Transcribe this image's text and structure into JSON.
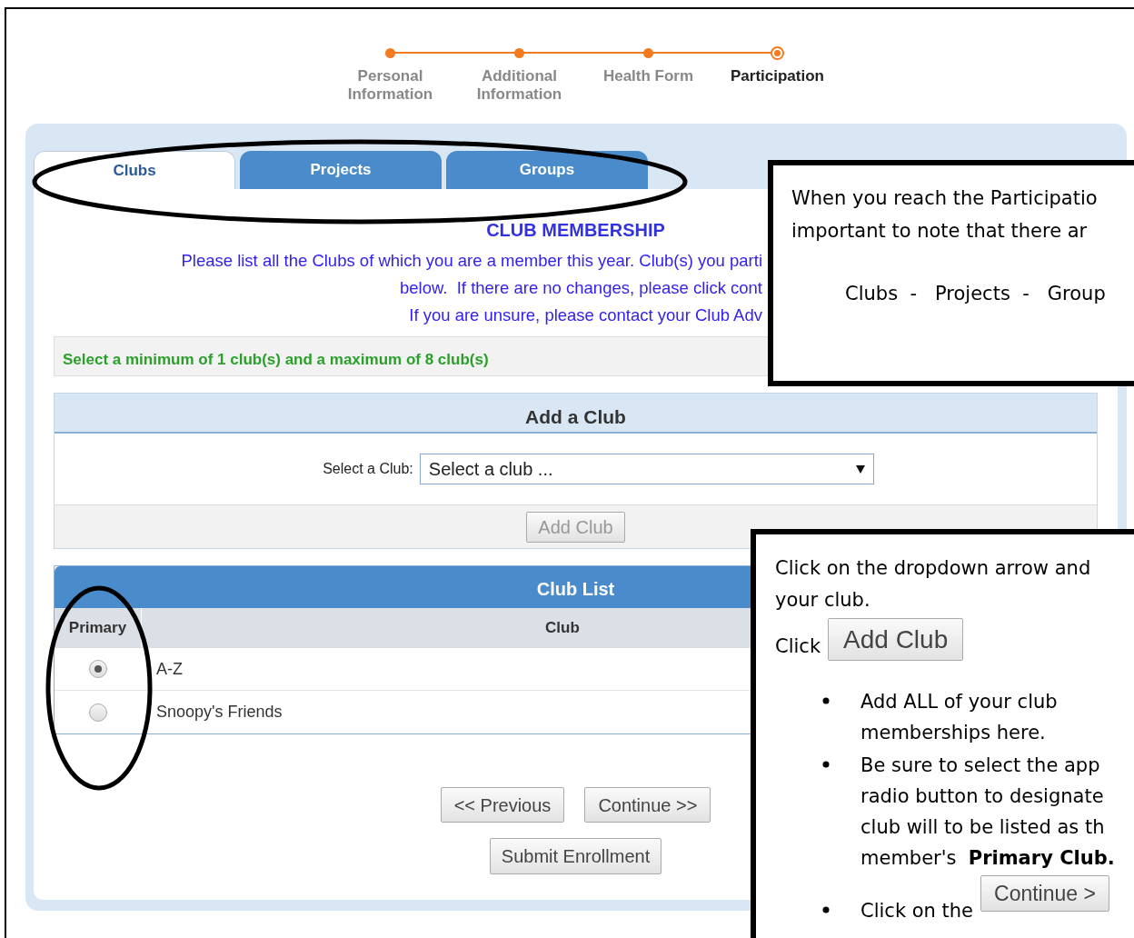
{
  "steps": [
    {
      "label": "Personal Information",
      "selected": false
    },
    {
      "label": "Additional Information",
      "selected": false
    },
    {
      "label": "Health Form",
      "selected": false
    },
    {
      "label": "Participation",
      "selected": true
    }
  ],
  "tabs": [
    {
      "label": "Clubs",
      "selected": true
    },
    {
      "label": "Projects",
      "selected": false
    },
    {
      "label": "Groups",
      "selected": false
    }
  ],
  "heading": "CLUB MEMBERSHIP",
  "intro_lines": [
    "Please list all the Clubs of which you are a member this year. Club(s) you parti",
    "below.  If there are no changes, please click cont",
    "If you are unsure, please contact your Club Adv"
  ],
  "notice": "Select a minimum of 1 club(s) and a maximum of 8 club(s)",
  "add_club": {
    "title": "Add a Club",
    "select_label": "Select a Club:",
    "select_value": "Select a club ...",
    "button": "Add Club"
  },
  "club_list": {
    "title": "Club List",
    "columns": [
      "Primary",
      "Club"
    ],
    "rows": [
      {
        "name": "A-Z",
        "selected": true
      },
      {
        "name": "Snoopy's Friends",
        "selected": false
      }
    ]
  },
  "nav_buttons": [
    "<< Previous",
    "Continue >>"
  ],
  "submit_button": "Submit Enrollment",
  "callout_1": {
    "lines": [
      "When you reach the Participatio",
      "important to note that there ar"
    ],
    "tabs_line": "Clubs  -   Projects  -   Group"
  },
  "callout_2": {
    "lines": [
      "Click on the dropdown arrow and",
      "your club."
    ],
    "click_label": "Click",
    "click_button": "Add Club",
    "bullets": [
      {
        "kind": "text",
        "lines": [
          "Add ALL of your club",
          "memberships here."
        ]
      },
      {
        "kind": "text",
        "lines": [
          "Be sure to select the app",
          "radio button to designate",
          "club will to be listed as th",
          "member's  **Primary Club.**"
        ]
      },
      {
        "kind": "button",
        "lines": [
          "Click on the"
        ],
        "button": "Continue >"
      }
    ]
  }
}
